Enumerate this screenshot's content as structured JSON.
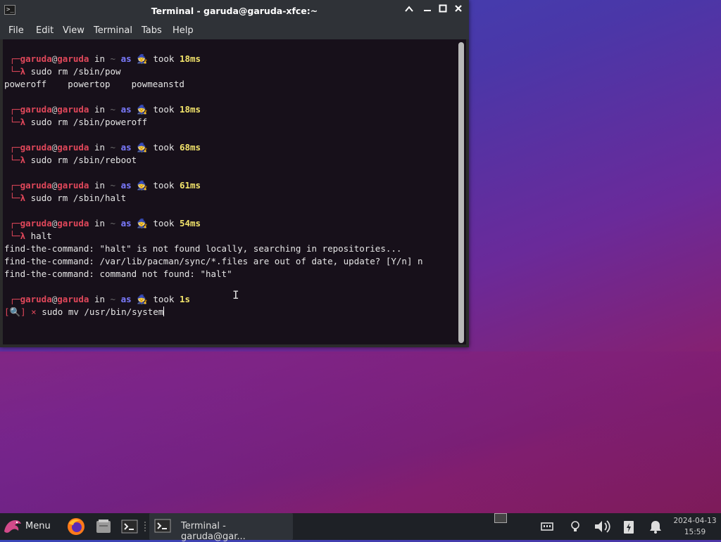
{
  "window": {
    "title": "Terminal - garuda@garuda-xfce:~",
    "minimize": "▲",
    "maximize": "▣",
    "close": "✕"
  },
  "menubar": [
    "File",
    "Edit",
    "View",
    "Terminal",
    "Tabs",
    "Help"
  ],
  "terminal": {
    "prompts": [
      {
        "user": "garuda",
        "host": "garuda",
        "took": "18ms",
        "cmd": "sudo rm /sbin/pow"
      },
      {
        "user": "garuda",
        "host": "garuda",
        "took": "18ms",
        "cmd": "sudo rm /sbin/poweroff"
      },
      {
        "user": "garuda",
        "host": "garuda",
        "took": "68ms",
        "cmd": "sudo rm /sbin/reboot"
      },
      {
        "user": "garuda",
        "host": "garuda",
        "took": "61ms",
        "cmd": "sudo rm /sbin/halt"
      },
      {
        "user": "garuda",
        "host": "garuda",
        "took": "54ms",
        "cmd": "halt"
      },
      {
        "user": "garuda",
        "host": "garuda",
        "took": "1s",
        "cmd": "sudo mv /usr/bin/system"
      }
    ],
    "in_word": "in",
    "tilde": "~",
    "as_word": "as",
    "took_word": "took",
    "completions": "poweroff    powertop    powmeanstd",
    "output_lines": [
      "find-the-command: \"halt\" is not found locally, searching in repositories...",
      "find-the-command: /var/lib/pacman/sync/*.files are out of date, update? [Y/n] n",
      "find-the-command: command not found: \"halt\""
    ],
    "last_prefix": "[🔍] ×"
  },
  "taskbar": {
    "menu_label": "Menu",
    "task_label": "Terminal - garuda@gar...",
    "clock_date": "2024-04-13",
    "clock_time": "15:59"
  }
}
